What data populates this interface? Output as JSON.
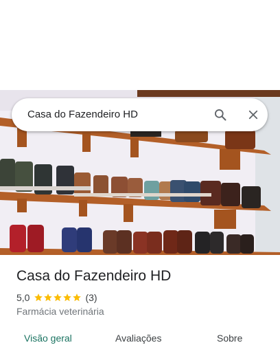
{
  "search": {
    "query": "Casa do Fazendeiro HD",
    "search_icon": "search-icon",
    "close_icon": "close-icon"
  },
  "place": {
    "name": "Casa do Fazendeiro HD",
    "rating": "5,0",
    "stars": 5,
    "review_count": "(3)",
    "category": "Farmácia veterinária"
  },
  "tabs": [
    {
      "label": "Visão geral",
      "active": true
    },
    {
      "label": "Avaliações",
      "active": false
    },
    {
      "label": "Sobre",
      "active": false
    }
  ],
  "colors": {
    "accent": "#1a7361",
    "star": "#fbbc04",
    "shelf": "#b5642b",
    "wall": "#f4f1f6"
  },
  "hero_image": "photo of boots on wooden wall shelves"
}
